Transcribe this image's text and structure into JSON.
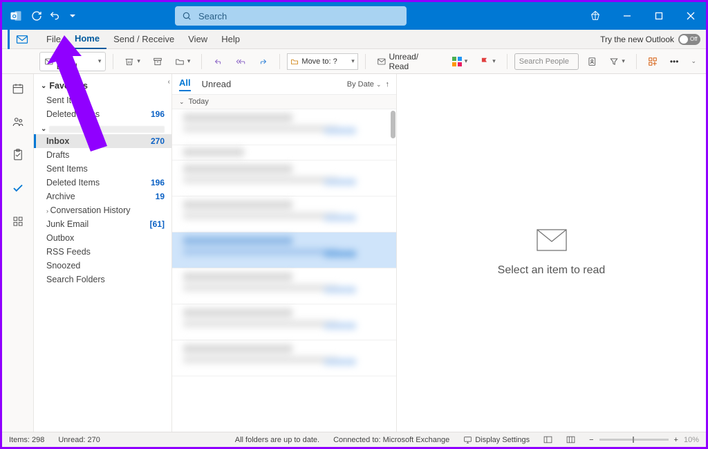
{
  "titlebar": {
    "search_placeholder": "Search"
  },
  "menubar": {
    "file": "File",
    "home": "Home",
    "send_receive": "Send / Receive",
    "view": "View",
    "help": "Help",
    "try_new": "Try the new Outlook",
    "toggle_state": "Off"
  },
  "ribbon": {
    "new_email": "New Email",
    "move_to": "Move to: ?",
    "unread_read": "Unread/ Read",
    "search_people_placeholder": "Search People"
  },
  "folder_pane": {
    "favorites_header": "Favorites",
    "favorites": [
      {
        "label": "Sent Items",
        "count": ""
      },
      {
        "label": "Deleted Items",
        "count": "196"
      }
    ],
    "account_folders": [
      {
        "label": "Inbox",
        "count": "270",
        "selected": true
      },
      {
        "label": "Drafts",
        "count": ""
      },
      {
        "label": "Sent Items",
        "count": ""
      },
      {
        "label": "Deleted Items",
        "count": "196"
      },
      {
        "label": "Archive",
        "count": "19"
      },
      {
        "label": "Conversation History",
        "count": "",
        "expandable": true
      },
      {
        "label": "Junk Email",
        "count": "[61]"
      },
      {
        "label": "Outbox",
        "count": ""
      },
      {
        "label": "RSS Feeds",
        "count": ""
      },
      {
        "label": "Snoozed",
        "count": ""
      },
      {
        "label": "Search Folders",
        "count": ""
      }
    ]
  },
  "maillist": {
    "tab_all": "All",
    "tab_unread": "Unread",
    "sort_label": "By Date",
    "group_today": "Today"
  },
  "reading": {
    "empty_msg": "Select an item to read"
  },
  "statusbar": {
    "items": "Items: 298",
    "unread": "Unread: 270",
    "sync": "All folders are up to date.",
    "connected": "Connected to: Microsoft Exchange",
    "display_settings": "Display Settings",
    "zoom": "10%"
  }
}
